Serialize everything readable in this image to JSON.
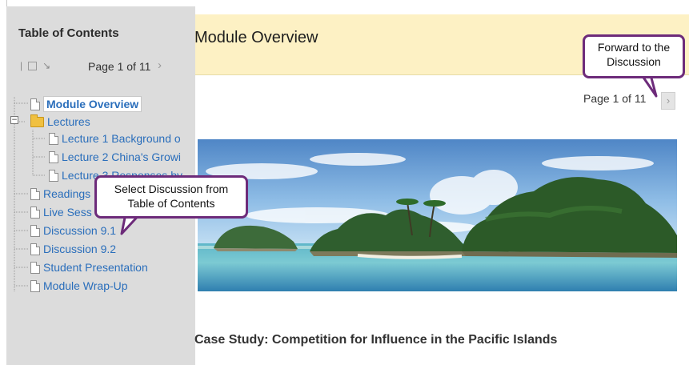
{
  "sidebar": {
    "title": "Table of Contents",
    "toolbar": {
      "tool_1": "|",
      "tool_3": "↘"
    },
    "page_indicator": "Page 1 of 11",
    "next_glyph": "›",
    "items": [
      {
        "label": "Module Overview",
        "type": "page",
        "selected": true
      },
      {
        "label": "Lectures",
        "type": "folder",
        "expanded": true
      },
      {
        "label": "Lecture 1 Background o",
        "type": "page",
        "indent": 1
      },
      {
        "label": "Lecture 2 China's Growi",
        "type": "page",
        "indent": 1
      },
      {
        "label": "Lecture 3 Responses by",
        "type": "page",
        "indent": 1
      },
      {
        "label": "Readings",
        "type": "page"
      },
      {
        "label": "Live Sess",
        "type": "page"
      },
      {
        "label": "Discussion 9.1",
        "type": "page"
      },
      {
        "label": "Discussion 9.2",
        "type": "page"
      },
      {
        "label": "Student Presentation",
        "type": "page"
      },
      {
        "label": "Module Wrap-Up",
        "type": "page"
      }
    ]
  },
  "main": {
    "title": "Module Overview",
    "page_indicator": "Page 1 of 11",
    "next_glyph": "›",
    "banner_icon": "tropical-island-photo",
    "section_heading": "Case Study: Competition for Influence in the Pacific Islands"
  },
  "callouts": {
    "forward": "Forward to the Discussion",
    "select": "Select Discussion from Table of Contents"
  },
  "colors": {
    "sidebar_bg": "#dcdcdc",
    "header_band": "#fdf1c4",
    "link_blue": "#2a6ebb",
    "callout_border": "#6d2b7a"
  }
}
